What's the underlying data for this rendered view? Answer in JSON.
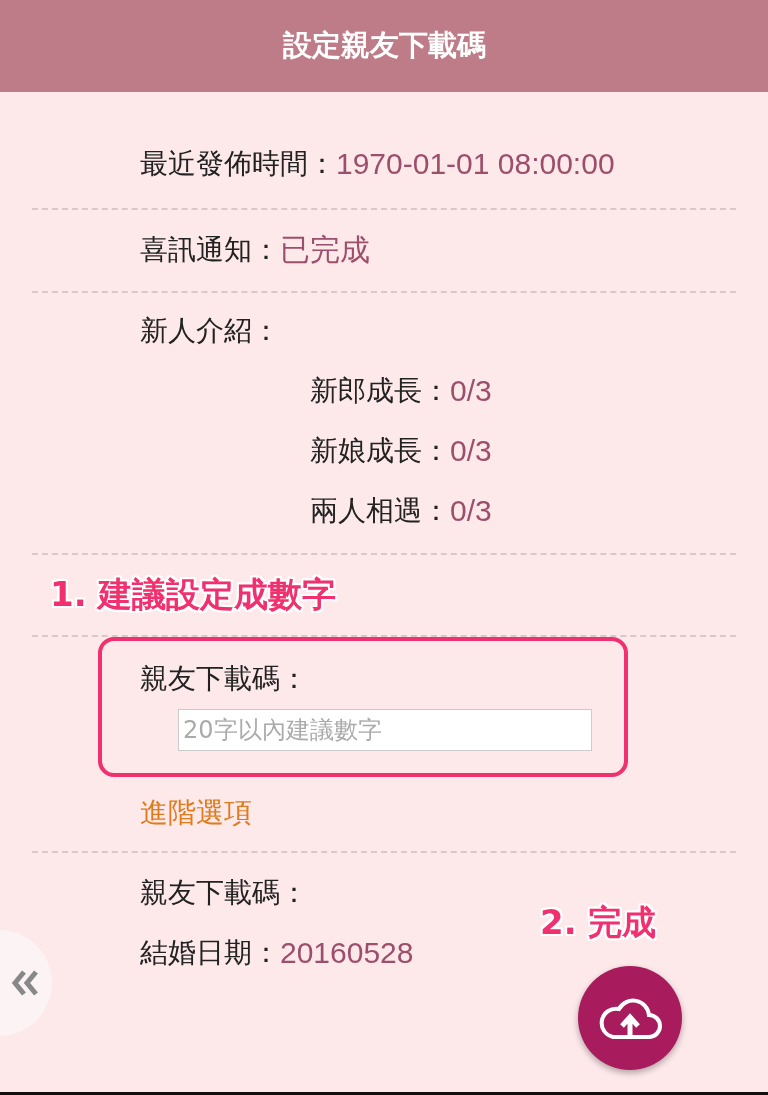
{
  "header": {
    "title": "設定親友下載碼"
  },
  "info": [
    {
      "label": "最近發佈時間：",
      "value": "1970-01-01 08:00:00"
    },
    {
      "label": "喜訊通知：",
      "value": "已完成"
    }
  ],
  "intro": {
    "label": "新人介紹：",
    "items": [
      {
        "label": "新郎成長：",
        "value": "0/3"
      },
      {
        "label": "新娘成長：",
        "value": "0/3"
      },
      {
        "label": "兩人相遇：",
        "value": "0/3"
      }
    ]
  },
  "annotations": [
    {
      "text": "1. 建議設定成數字"
    },
    {
      "text": "2. 完成"
    }
  ],
  "download_code": {
    "label": "親友下載碼：",
    "placeholder": "20字以內建議數字"
  },
  "advanced_link": "進階選項",
  "summary": [
    {
      "label": "親友下載碼："
    },
    {
      "label": "結婚日期：",
      "value": "20160528"
    }
  ]
}
